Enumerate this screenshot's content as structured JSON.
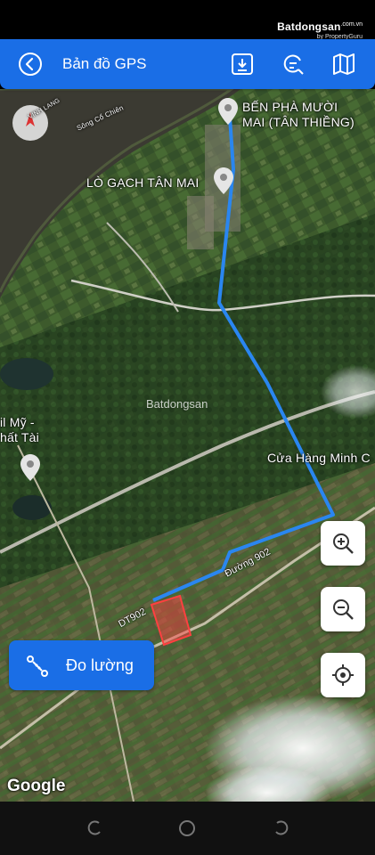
{
  "status_bar": {
    "watermark_brand": "Batdongsan",
    "watermark_domain": ".com.vn",
    "watermark_sub": "by PropertyGuru"
  },
  "header": {
    "title": "Bản đồ GPS",
    "back_icon": "chevron-left-circle-icon",
    "tools": [
      "download-icon",
      "search-location-icon",
      "map-icon"
    ],
    "accent_color": "#1a6ee6"
  },
  "map": {
    "river_label": "Sông Cổ Chiên",
    "corner_label": "VINH LANG",
    "places": [
      {
        "name_line1": "BẾN PHÀ MƯỜI",
        "name_line2": "MAI (TÂN THIỀNG)"
      },
      {
        "name_line1": "LÒ GẠCH TÂN MAI"
      },
      {
        "name_line1": "Cửa Hàng Minh C"
      },
      {
        "name_line1": "il Mỹ -",
        "name_line2": "hất Tài"
      }
    ],
    "road_labels": [
      "Đường 902",
      "DT902"
    ],
    "route_color": "#2a86f0",
    "parcel_color": "#ff4040",
    "center_watermark": "Batdongsan",
    "attribution": "Google"
  },
  "controls": {
    "zoom_in_icon": "zoom-in-icon",
    "zoom_out_icon": "zoom-out-icon",
    "locate_icon": "my-location-icon",
    "measure_label": "Đo lường",
    "measure_icon": "ruler-route-icon"
  }
}
